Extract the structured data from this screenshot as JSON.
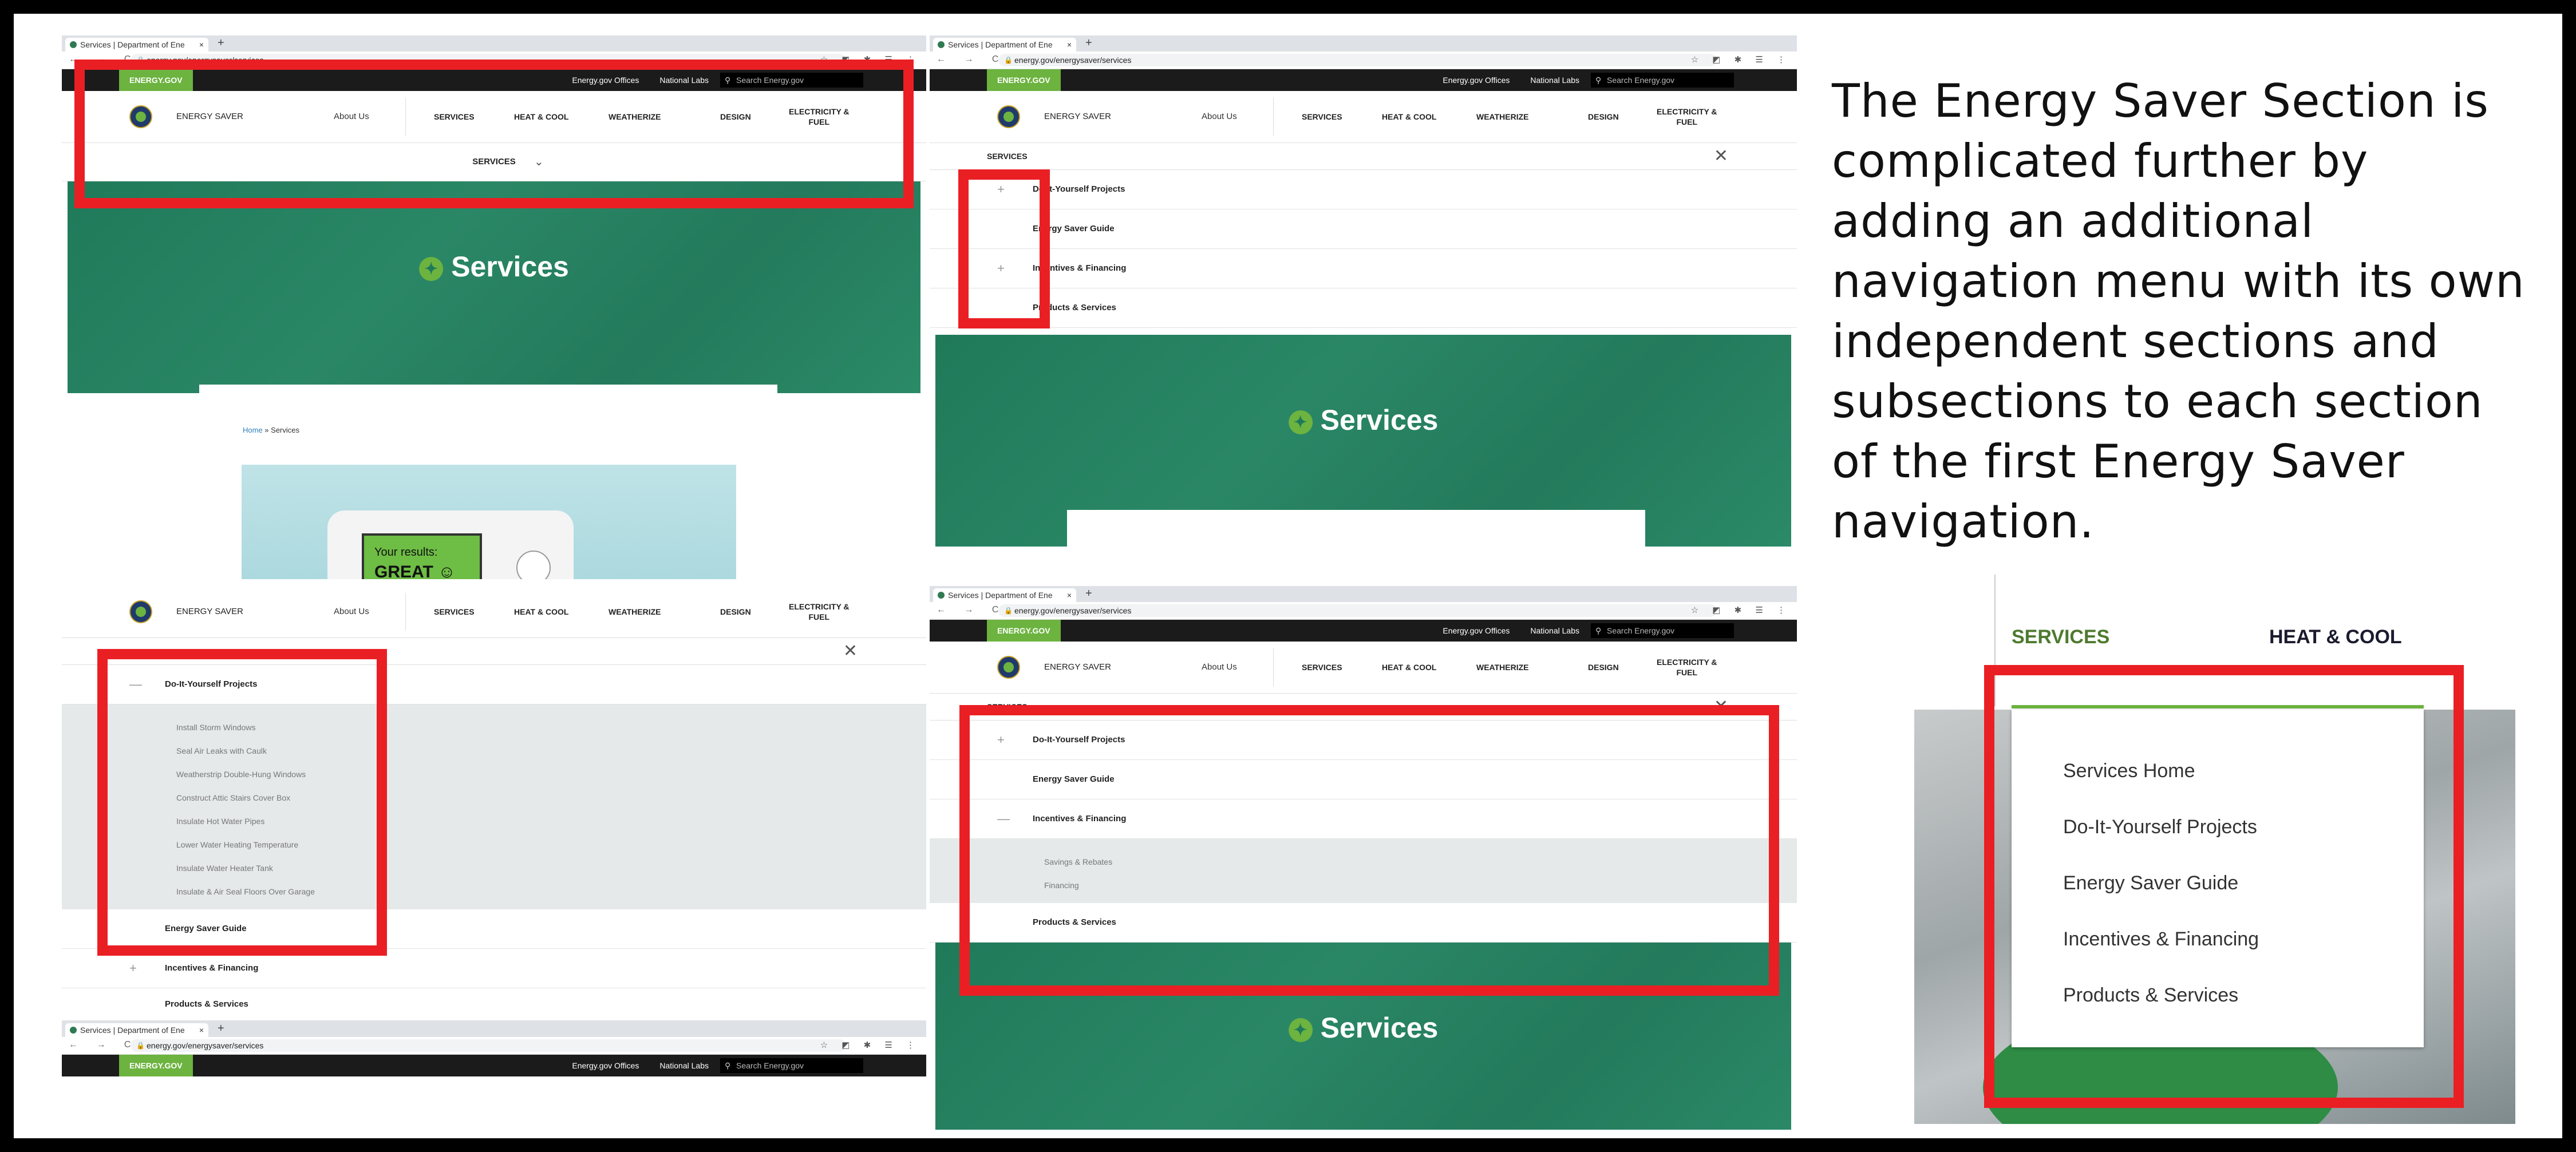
{
  "browser": {
    "tab_title": "Services | Department of Ene",
    "tab_close": "×",
    "new_tab": "+",
    "url": "energy.gov/energysaver/services",
    "nav_glyphs": "← → C",
    "ext_glyphs": "☆ ◩ ✱ ☰ ⋮"
  },
  "site": {
    "utility": {
      "energy_gov": "ENERGY.GOV",
      "offices": "Energy.gov Offices",
      "labs": "National Labs",
      "search_placeholder": "Search Energy.gov"
    },
    "brand": "ENERGY SAVER",
    "about": "About Us",
    "nav": [
      "SERVICES",
      "HEAT & COOL",
      "WEATHERIZE",
      "DESIGN",
      "ELECTRICITY &"
    ],
    "nav_fuel": "FUEL",
    "services_label": "SERVICES",
    "hero_title": "Services",
    "breadcrumb_home": "Home",
    "breadcrumb_sep": " » ",
    "breadcrumb_current": "Services",
    "thermostat_results": "Your results:",
    "thermostat_great": "GREAT ☺☺"
  },
  "menu": {
    "header": "SERVICES",
    "close": "✕",
    "plus": "+",
    "minus": "—",
    "items": [
      "Do-It-Yourself Projects",
      "Energy Saver Guide",
      "Incentives & Financing",
      "Products & Services"
    ],
    "diy_subitems": [
      "Install Storm Windows",
      "Seal Air Leaks with Caulk",
      "Weatherstrip Double-Hung Windows",
      "Construct Attic Stairs Cover Box",
      "Insulate Hot Water Pipes",
      "Lower Water Heating Temperature",
      "Insulate Water Heater Tank",
      "Insulate & Air Seal Floors Over Garage"
    ],
    "incentives_subitems": [
      "Savings & Rebates",
      "Financing"
    ]
  },
  "caption": "The Energy Saver Section is complicated further by adding an additional navigation menu with its own independent sections and subsections to each section of the first Energy Saver navigation.",
  "zoom": {
    "services": "SERVICES",
    "heat_cool": "HEAT & COOL",
    "items": [
      "Services Home",
      "Do-It-Yourself Projects",
      "Energy Saver Guide",
      "Incentives & Financing",
      "Products & Services"
    ]
  },
  "colors": {
    "highlight": "#ea1f24",
    "energy_green": "#6cb33f",
    "hero_teal": "#237a5c"
  }
}
